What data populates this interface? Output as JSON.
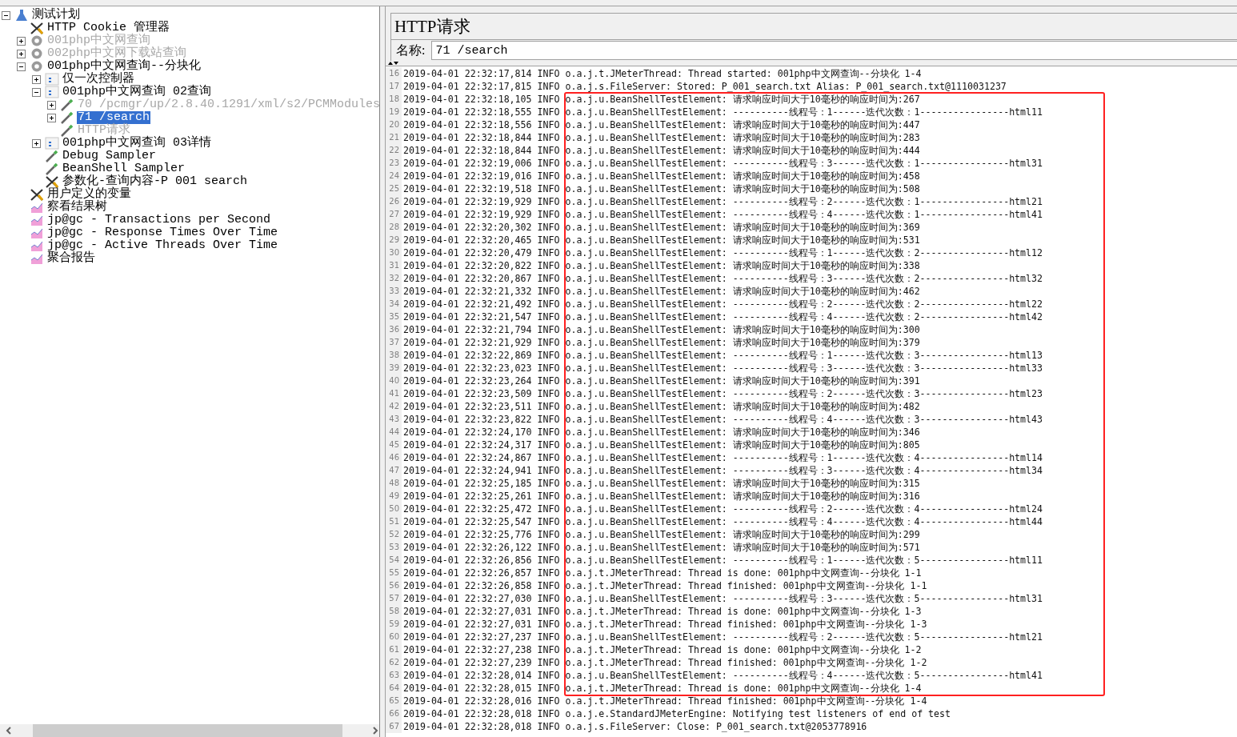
{
  "tree": [
    {
      "label": "测试计划",
      "kind": "plan",
      "disabled": false,
      "selected": false,
      "expanded": true,
      "children": [
        {
          "label": "HTTP Cookie 管理器",
          "kind": "config",
          "disabled": false,
          "selected": false
        },
        {
          "label": "001php中文网查询",
          "kind": "thread",
          "disabled": true,
          "selected": false,
          "expanded": false
        },
        {
          "label": "002php中文网下载站查询",
          "kind": "thread",
          "disabled": true,
          "selected": false,
          "expanded": false
        },
        {
          "label": "001php中文网查询--分块化",
          "kind": "thread",
          "disabled": false,
          "selected": false,
          "expanded": true,
          "children": [
            {
              "label": "仅一次控制器",
              "kind": "controller",
              "disabled": false,
              "selected": false,
              "expanded": false
            },
            {
              "label": "001php中文网查询 02查询",
              "kind": "controller",
              "disabled": false,
              "selected": false,
              "expanded": true,
              "children": [
                {
                  "label": "70 /pcmgr/up/2.8.40.1291/xml/s2/PCMModules",
                  "kind": "sampler",
                  "disabled": true,
                  "selected": false,
                  "expanded": false
                },
                {
                  "label": "71 /search",
                  "kind": "sampler",
                  "disabled": false,
                  "selected": true,
                  "expanded": false
                },
                {
                  "label": "HTTP请求",
                  "kind": "sampler",
                  "disabled": true,
                  "selected": false
                }
              ]
            },
            {
              "label": "001php中文网查询 03详情",
              "kind": "controller",
              "disabled": false,
              "selected": false,
              "expanded": false
            },
            {
              "label": "Debug Sampler",
              "kind": "sampler",
              "disabled": false,
              "selected": false
            },
            {
              "label": "BeanShell Sampler",
              "kind": "sampler",
              "disabled": false,
              "selected": false
            },
            {
              "label": "参数化-查询内容-P 001 search",
              "kind": "config",
              "disabled": false,
              "selected": false
            }
          ]
        },
        {
          "label": "用户定义的变量",
          "kind": "config",
          "disabled": false,
          "selected": false
        },
        {
          "label": "察看结果树",
          "kind": "listener",
          "disabled": false,
          "selected": false
        },
        {
          "label": "jp@gc - Transactions per Second",
          "kind": "listener",
          "disabled": false,
          "selected": false
        },
        {
          "label": "jp@gc - Response Times Over Time",
          "kind": "listener",
          "disabled": false,
          "selected": false
        },
        {
          "label": "jp@gc - Active Threads Over Time",
          "kind": "listener",
          "disabled": false,
          "selected": false
        },
        {
          "label": "聚合报告",
          "kind": "listener",
          "disabled": false,
          "selected": false
        }
      ]
    }
  ],
  "panel": {
    "title": "HTTP请求",
    "name_label": "名称:",
    "name_value": "71 /search"
  },
  "log": [
    {
      "n": "16",
      "text": "2019-04-01 22:32:17,814 INFO o.a.j.t.JMeterThread: Thread started: 001php中文网查询--分块化 1-4"
    },
    {
      "n": "17",
      "text": "2019-04-01 22:32:17,815 INFO o.a.j.s.FileServer: Stored: P_001_search.txt Alias: P_001_search.txt@1110031237"
    },
    {
      "n": "18",
      "text": "2019-04-01 22:32:18,105 INFO o.a.j.u.BeanShellTestElement: 请求响应时间大于10毫秒的响应时间为:267"
    },
    {
      "n": "19",
      "text": "2019-04-01 22:32:18,555 INFO o.a.j.u.BeanShellTestElement: ----------线程号：1------迭代次数：1----------------html11"
    },
    {
      "n": "20",
      "text": "2019-04-01 22:32:18,556 INFO o.a.j.u.BeanShellTestElement: 请求响应时间大于10毫秒的响应时间为:447"
    },
    {
      "n": "21",
      "text": "2019-04-01 22:32:18,844 INFO o.a.j.u.BeanShellTestElement: 请求响应时间大于10毫秒的响应时间为:283"
    },
    {
      "n": "22",
      "text": "2019-04-01 22:32:18,844 INFO o.a.j.u.BeanShellTestElement: 请求响应时间大于10毫秒的响应时间为:444"
    },
    {
      "n": "23",
      "text": "2019-04-01 22:32:19,006 INFO o.a.j.u.BeanShellTestElement: ----------线程号：3------迭代次数：1----------------html31"
    },
    {
      "n": "24",
      "text": "2019-04-01 22:32:19,016 INFO o.a.j.u.BeanShellTestElement: 请求响应时间大于10毫秒的响应时间为:458"
    },
    {
      "n": "25",
      "text": "2019-04-01 22:32:19,518 INFO o.a.j.u.BeanShellTestElement: 请求响应时间大于10毫秒的响应时间为:508"
    },
    {
      "n": "26",
      "text": "2019-04-01 22:32:19,929 INFO o.a.j.u.BeanShellTestElement: ----------线程号：2------迭代次数：1----------------html21"
    },
    {
      "n": "27",
      "text": "2019-04-01 22:32:19,929 INFO o.a.j.u.BeanShellTestElement: ----------线程号：4------迭代次数：1----------------html41"
    },
    {
      "n": "28",
      "text": "2019-04-01 22:32:20,302 INFO o.a.j.u.BeanShellTestElement: 请求响应时间大于10毫秒的响应时间为:369"
    },
    {
      "n": "29",
      "text": "2019-04-01 22:32:20,465 INFO o.a.j.u.BeanShellTestElement: 请求响应时间大于10毫秒的响应时间为:531"
    },
    {
      "n": "30",
      "text": "2019-04-01 22:32:20,479 INFO o.a.j.u.BeanShellTestElement: ----------线程号：1------迭代次数：2----------------html12"
    },
    {
      "n": "31",
      "text": "2019-04-01 22:32:20,822 INFO o.a.j.u.BeanShellTestElement: 请求响应时间大于10毫秒的响应时间为:338"
    },
    {
      "n": "32",
      "text": "2019-04-01 22:32:20,867 INFO o.a.j.u.BeanShellTestElement: ----------线程号：3------迭代次数：2----------------html32"
    },
    {
      "n": "33",
      "text": "2019-04-01 22:32:21,332 INFO o.a.j.u.BeanShellTestElement: 请求响应时间大于10毫秒的响应时间为:462"
    },
    {
      "n": "34",
      "text": "2019-04-01 22:32:21,492 INFO o.a.j.u.BeanShellTestElement: ----------线程号：2------迭代次数：2----------------html22"
    },
    {
      "n": "35",
      "text": "2019-04-01 22:32:21,547 INFO o.a.j.u.BeanShellTestElement: ----------线程号：4------迭代次数：2----------------html42"
    },
    {
      "n": "36",
      "text": "2019-04-01 22:32:21,794 INFO o.a.j.u.BeanShellTestElement: 请求响应时间大于10毫秒的响应时间为:300"
    },
    {
      "n": "37",
      "text": "2019-04-01 22:32:21,929 INFO o.a.j.u.BeanShellTestElement: 请求响应时间大于10毫秒的响应时间为:379"
    },
    {
      "n": "38",
      "text": "2019-04-01 22:32:22,869 INFO o.a.j.u.BeanShellTestElement: ----------线程号：1------迭代次数：3----------------html13"
    },
    {
      "n": "39",
      "text": "2019-04-01 22:32:23,023 INFO o.a.j.u.BeanShellTestElement: ----------线程号：3------迭代次数：3----------------html33"
    },
    {
      "n": "40",
      "text": "2019-04-01 22:32:23,264 INFO o.a.j.u.BeanShellTestElement: 请求响应时间大于10毫秒的响应时间为:391"
    },
    {
      "n": "41",
      "text": "2019-04-01 22:32:23,509 INFO o.a.j.u.BeanShellTestElement: ----------线程号：2------迭代次数：3----------------html23"
    },
    {
      "n": "42",
      "text": "2019-04-01 22:32:23,511 INFO o.a.j.u.BeanShellTestElement: 请求响应时间大于10毫秒的响应时间为:482"
    },
    {
      "n": "43",
      "text": "2019-04-01 22:32:23,822 INFO o.a.j.u.BeanShellTestElement: ----------线程号：4------迭代次数：3----------------html43"
    },
    {
      "n": "44",
      "text": "2019-04-01 22:32:24,170 INFO o.a.j.u.BeanShellTestElement: 请求响应时间大于10毫秒的响应时间为:346"
    },
    {
      "n": "45",
      "text": "2019-04-01 22:32:24,317 INFO o.a.j.u.BeanShellTestElement: 请求响应时间大于10毫秒的响应时间为:805"
    },
    {
      "n": "46",
      "text": "2019-04-01 22:32:24,867 INFO o.a.j.u.BeanShellTestElement: ----------线程号：1------迭代次数：4----------------html14"
    },
    {
      "n": "47",
      "text": "2019-04-01 22:32:24,941 INFO o.a.j.u.BeanShellTestElement: ----------线程号：3------迭代次数：4----------------html34"
    },
    {
      "n": "48",
      "text": "2019-04-01 22:32:25,185 INFO o.a.j.u.BeanShellTestElement: 请求响应时间大于10毫秒的响应时间为:315"
    },
    {
      "n": "49",
      "text": "2019-04-01 22:32:25,261 INFO o.a.j.u.BeanShellTestElement: 请求响应时间大于10毫秒的响应时间为:316"
    },
    {
      "n": "50",
      "text": "2019-04-01 22:32:25,472 INFO o.a.j.u.BeanShellTestElement: ----------线程号：2------迭代次数：4----------------html24"
    },
    {
      "n": "51",
      "text": "2019-04-01 22:32:25,547 INFO o.a.j.u.BeanShellTestElement: ----------线程号：4------迭代次数：4----------------html44"
    },
    {
      "n": "52",
      "text": "2019-04-01 22:32:25,776 INFO o.a.j.u.BeanShellTestElement: 请求响应时间大于10毫秒的响应时间为:299"
    },
    {
      "n": "53",
      "text": "2019-04-01 22:32:26,122 INFO o.a.j.u.BeanShellTestElement: 请求响应时间大于10毫秒的响应时间为:571"
    },
    {
      "n": "54",
      "text": "2019-04-01 22:32:26,856 INFO o.a.j.u.BeanShellTestElement: ----------线程号：1------迭代次数：5----------------html11"
    },
    {
      "n": "55",
      "text": "2019-04-01 22:32:26,857 INFO o.a.j.t.JMeterThread: Thread is done: 001php中文网查询--分块化 1-1"
    },
    {
      "n": "56",
      "text": "2019-04-01 22:32:26,858 INFO o.a.j.t.JMeterThread: Thread finished: 001php中文网查询--分块化 1-1"
    },
    {
      "n": "57",
      "text": "2019-04-01 22:32:27,030 INFO o.a.j.u.BeanShellTestElement: ----------线程号：3------迭代次数：5----------------html31"
    },
    {
      "n": "58",
      "text": "2019-04-01 22:32:27,031 INFO o.a.j.t.JMeterThread: Thread is done: 001php中文网查询--分块化 1-3"
    },
    {
      "n": "59",
      "text": "2019-04-01 22:32:27,031 INFO o.a.j.t.JMeterThread: Thread finished: 001php中文网查询--分块化 1-3"
    },
    {
      "n": "60",
      "text": "2019-04-01 22:32:27,237 INFO o.a.j.u.BeanShellTestElement: ----------线程号：2------迭代次数：5----------------html21"
    },
    {
      "n": "61",
      "text": "2019-04-01 22:32:27,238 INFO o.a.j.t.JMeterThread: Thread is done: 001php中文网查询--分块化 1-2"
    },
    {
      "n": "62",
      "text": "2019-04-01 22:32:27,239 INFO o.a.j.t.JMeterThread: Thread finished: 001php中文网查询--分块化 1-2"
    },
    {
      "n": "63",
      "text": "2019-04-01 22:32:28,014 INFO o.a.j.u.BeanShellTestElement: ----------线程号：4------迭代次数：5----------------html41"
    },
    {
      "n": "64",
      "text": "2019-04-01 22:32:28,015 INFO o.a.j.t.JMeterThread: Thread is done: 001php中文网查询--分块化 1-4"
    },
    {
      "n": "65",
      "text": "2019-04-01 22:32:28,016 INFO o.a.j.t.JMeterThread: Thread finished: 001php中文网查询--分块化 1-4"
    },
    {
      "n": "66",
      "text": "2019-04-01 22:32:28,018 INFO o.a.j.e.StandardJMeterEngine: Notifying test listeners of end of test"
    },
    {
      "n": "67",
      "text": "2019-04-01 22:32:28,018 INFO o.a.j.s.FileServer: Close: P_001_search.txt@2053778916"
    }
  ]
}
